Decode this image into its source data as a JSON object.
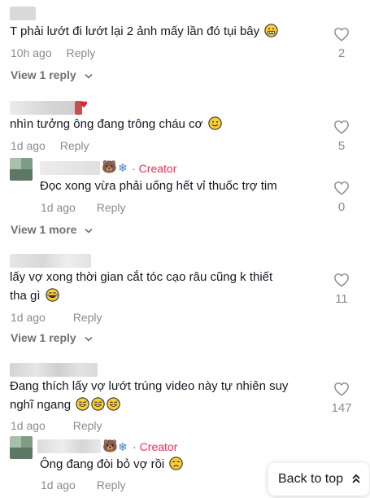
{
  "comments": [
    {
      "text": "T phải lướt đi lướt lại 2 ảnh mấy lần đó tụi bây",
      "emoji": "grinning-face",
      "time": "10h ago",
      "reply_label": "Reply",
      "likes": "2",
      "view_replies": "View 1 reply"
    },
    {
      "text": "nhìn tưởng ông đang trông cháu cơ",
      "emoji": "smiling-face",
      "time": "1d ago",
      "reply_label": "Reply",
      "likes": "5",
      "reply": {
        "badge": "Creator",
        "separator": "·",
        "text": "Đọc xong vừa phải uống hết vỉ thuốc trợ tim",
        "time": "1d ago",
        "reply_label": "Reply",
        "likes": "0"
      },
      "view_more": "View 1 more"
    },
    {
      "text_line1": "lấy vợ xong thời gian cắt tóc cạo râu cũng k thiết",
      "text_line2": "tha gì",
      "emoji": "tears-of-joy-face",
      "time": "1d ago",
      "reply_label": "Reply",
      "likes": "11",
      "view_replies": "View 1 reply"
    },
    {
      "text_line1": "Đang thích lấy vợ lướt trúng video này tự nhiên suy",
      "text_line2": "nghĩ ngang",
      "emoji": "sweat-smile-face",
      "time": "1d ago",
      "reply_label": "Reply",
      "likes": "147",
      "reply": {
        "badge": "Creator",
        "separator": "·",
        "text": "Ông đang đòi bỏ vợ rồi",
        "emoji": "weary-face",
        "time": "1d ago",
        "reply_label": "Reply"
      }
    }
  ],
  "back_to_top": "Back to top",
  "colors": {
    "creator": "#fe2c55",
    "muted": "#8a8b91",
    "text": "#161823"
  }
}
